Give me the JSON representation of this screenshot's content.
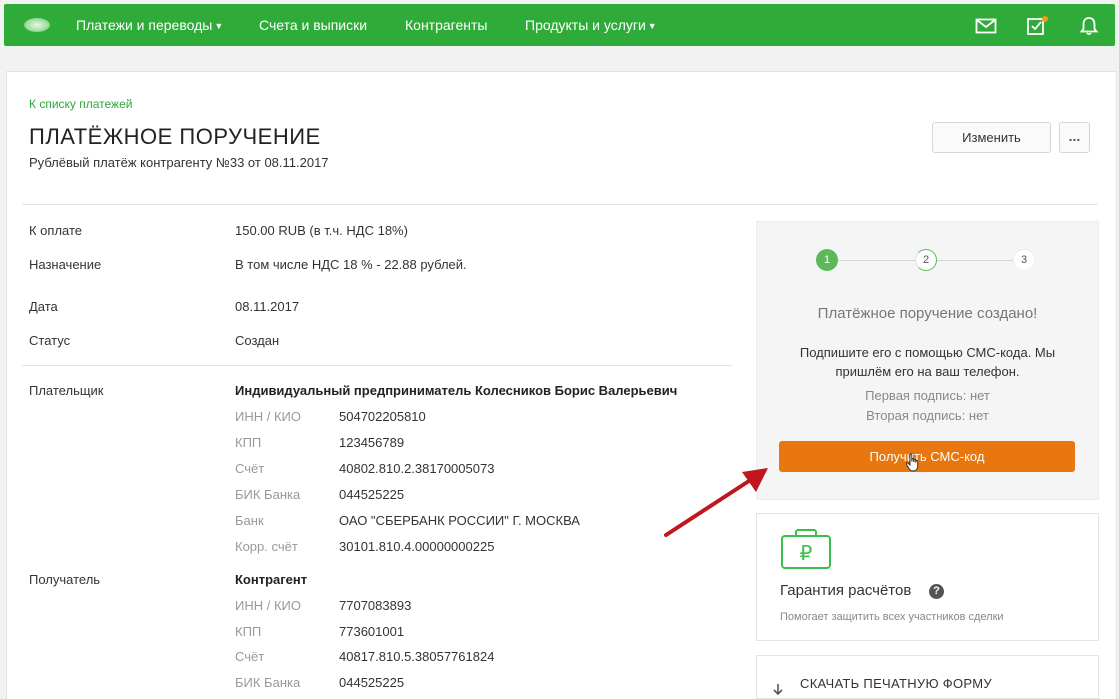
{
  "nav": {
    "items": [
      {
        "label": "Платежи и переводы",
        "dropdown": true
      },
      {
        "label": "Счета и выписки",
        "dropdown": false
      },
      {
        "label": "Контрагенты",
        "dropdown": false
      },
      {
        "label": "Продукты и услуги",
        "dropdown": true
      }
    ],
    "icons": [
      "mail-icon",
      "tasks-icon",
      "bell-icon"
    ]
  },
  "header": {
    "back_link": "К списку платежей",
    "title": "ПЛАТЁЖНОЕ ПОРУЧЕНИЕ",
    "subtitle": "Рублёвый платёж контрагенту №33 от 08.11.2017",
    "change_button": "Изменить",
    "more_button": "..."
  },
  "details": {
    "to_pay_label": "К оплате",
    "to_pay_value": "150.00 RUB (в т.ч. НДС 18%)",
    "purpose_label": "Назначение",
    "purpose_value": "В том числе НДС 18 % - 22.88 рублей.",
    "date_label": "Дата",
    "date_value": "08.11.2017",
    "status_label": "Статус",
    "status_value": "Создан"
  },
  "payer": {
    "label": "Плательщик",
    "name": "Индивидуальный предприниматель Колесников Борис Валерьевич",
    "fields": [
      {
        "label": "ИНН / КИО",
        "value": "504702205810"
      },
      {
        "label": "КПП",
        "value": "123456789"
      },
      {
        "label": "Счёт",
        "value": "40802.810.2.38170005073"
      },
      {
        "label": "БИК Банка",
        "value": "044525225"
      },
      {
        "label": "Банк",
        "value": "ОАО \"СБЕРБАНК РОССИИ\" Г. МОСКВА"
      },
      {
        "label": "Корр. счёт",
        "value": "30101.810.4.00000000225"
      }
    ]
  },
  "recipient": {
    "label": "Получатель",
    "name": "Контрагент",
    "fields": [
      {
        "label": "ИНН / КИО",
        "value": "7707083893"
      },
      {
        "label": "КПП",
        "value": "773601001"
      },
      {
        "label": "Счёт",
        "value": "40817.810.5.38057761824"
      },
      {
        "label": "БИК Банка",
        "value": "044525225"
      }
    ]
  },
  "side_panel": {
    "steps": [
      "1",
      "2",
      "3"
    ],
    "current_step": 2,
    "heading": "Платёжное поручение создано!",
    "description_line1": "Подпишите его с помощью СМС-кода. Мы",
    "description_line2": "пришлём его на ваш телефон.",
    "first_signature": "Первая подпись: нет",
    "second_signature": "Вторая подпись: нет",
    "sms_button": "Получить СМС-код",
    "sms_button_color": "#e8770f"
  },
  "guarantee": {
    "title": "Гарантия расчётов",
    "description": "Помогает защитить всех участников сделки",
    "icon": "ruble-briefcase-icon"
  },
  "download": {
    "label": "СКАЧАТЬ ПЕЧАТНУЮ ФОРМУ"
  },
  "colors": {
    "brand_green": "#2fab3a",
    "link_green": "#2fa53a",
    "accent_orange": "#e8770f",
    "annotation_red": "#c0161d"
  }
}
